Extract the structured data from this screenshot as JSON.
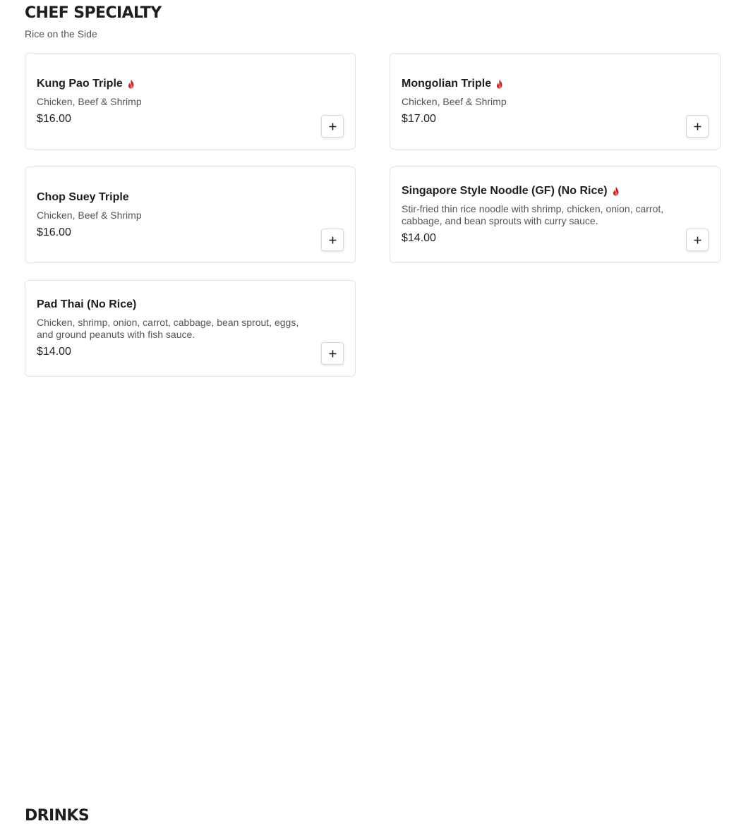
{
  "sections": {
    "chef": {
      "title": "CHEF SPECIALTY",
      "subtitle": "Rice on the Side"
    },
    "drinks": {
      "title": "DRINKS"
    }
  },
  "colors": {
    "spicy": "#c62828",
    "text": "#1e1e1e",
    "muted": "#555555",
    "border": "#e3e3e3"
  },
  "items": [
    {
      "name": "Kung Pao Triple",
      "spicy": true,
      "description": "Chicken, Beef & Shrimp",
      "price": "$16.00",
      "icon": "plus-icon"
    },
    {
      "name": "Mongolian Triple",
      "spicy": true,
      "description": "Chicken, Beef & Shrimp",
      "price": "$17.00",
      "icon": "plus-icon"
    },
    {
      "name": "Chop Suey Triple",
      "spicy": false,
      "description": "Chicken, Beef & Shrimp",
      "price": "$16.00",
      "icon": "plus-icon"
    },
    {
      "name": "Singapore Style Noodle (GF) (No Rice)",
      "spicy": true,
      "description": "Stir-fried thin rice noodle with shrimp, chicken, onion, carrot, cabbage, and bean sprouts with curry sauce.",
      "price": "$14.00",
      "icon": "plus-icon"
    },
    {
      "name": "Pad Thai (No Rice)",
      "spicy": false,
      "description": "Chicken, shrimp, onion, carrot, cabbage, bean sprout, eggs, and ground peanuts with fish sauce.",
      "price": "$14.00",
      "icon": "plus-icon"
    }
  ]
}
